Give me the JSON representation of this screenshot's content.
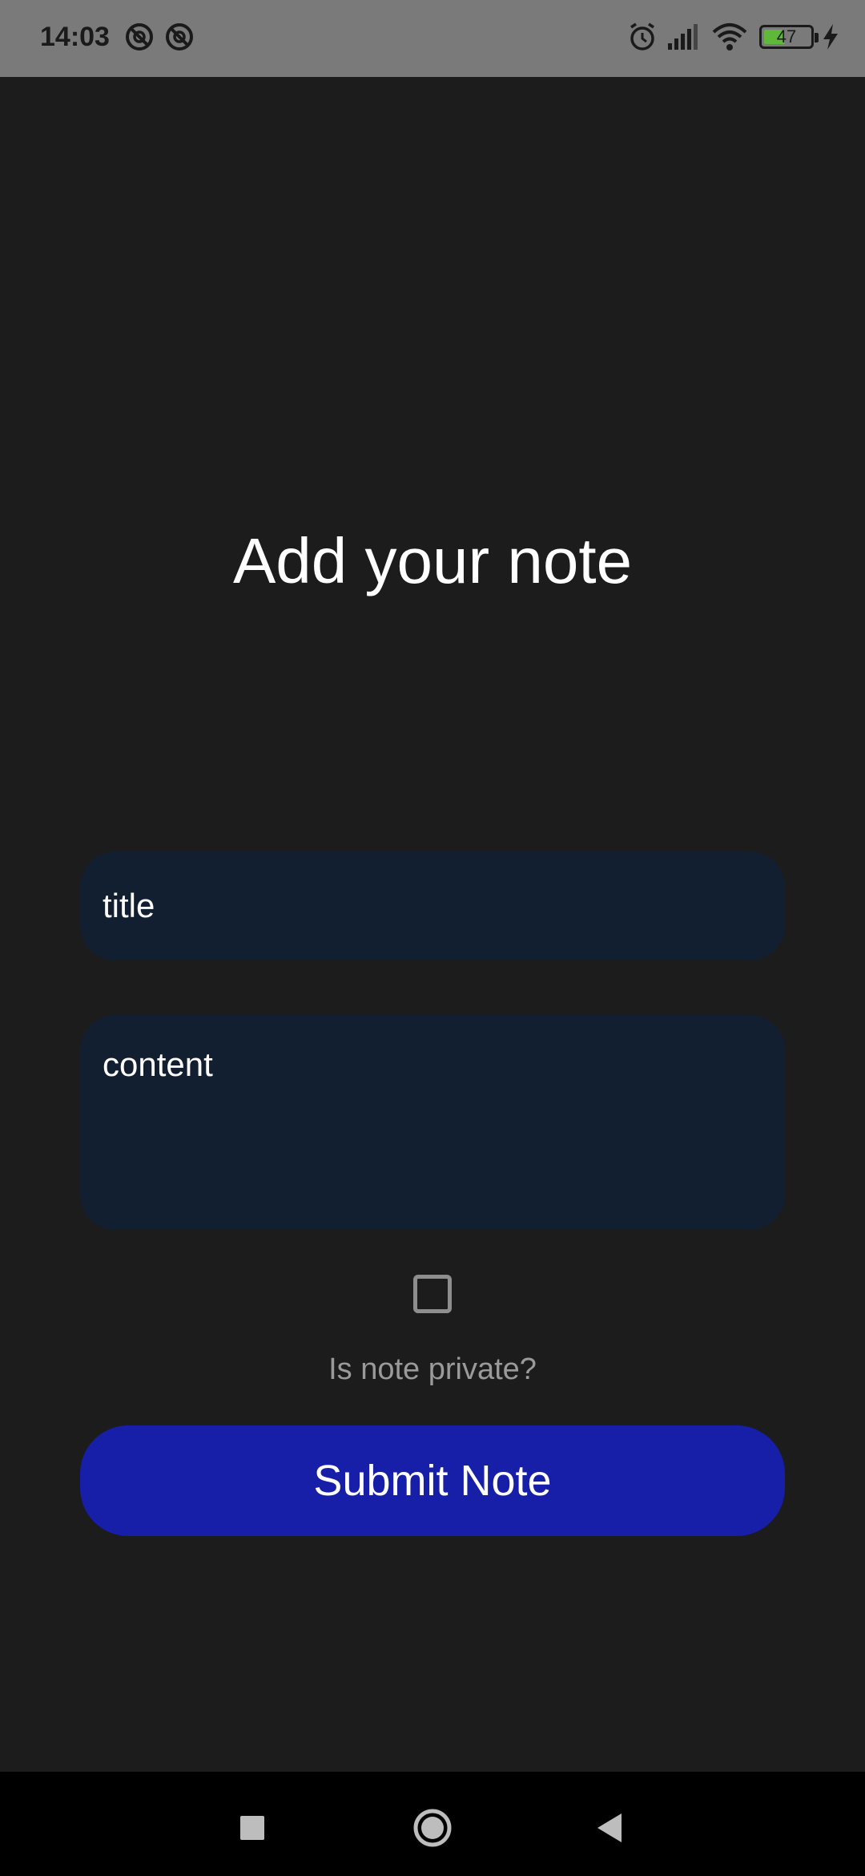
{
  "status_bar": {
    "time": "14:03",
    "battery_level": "47",
    "battery_fraction": 0.47,
    "icons": [
      "notification-off-icon",
      "notification-off-icon",
      "alarm-icon",
      "signal-icon",
      "wifi-icon",
      "battery-icon",
      "charging-icon"
    ]
  },
  "page": {
    "title": "Add your note"
  },
  "form": {
    "title_placeholder": "title",
    "content_placeholder": "content",
    "private_label": "Is note private?",
    "private_checked": false,
    "submit_label": "Submit Note"
  },
  "colors": {
    "background": "#1c1c1c",
    "status_bar": "#7a7a7a",
    "field_bg": "#121f31",
    "button_bg": "#171fa8",
    "battery_fill": "#5fb83a"
  },
  "nav_bar": {
    "icons": [
      "recents-icon",
      "home-icon",
      "back-icon"
    ]
  }
}
